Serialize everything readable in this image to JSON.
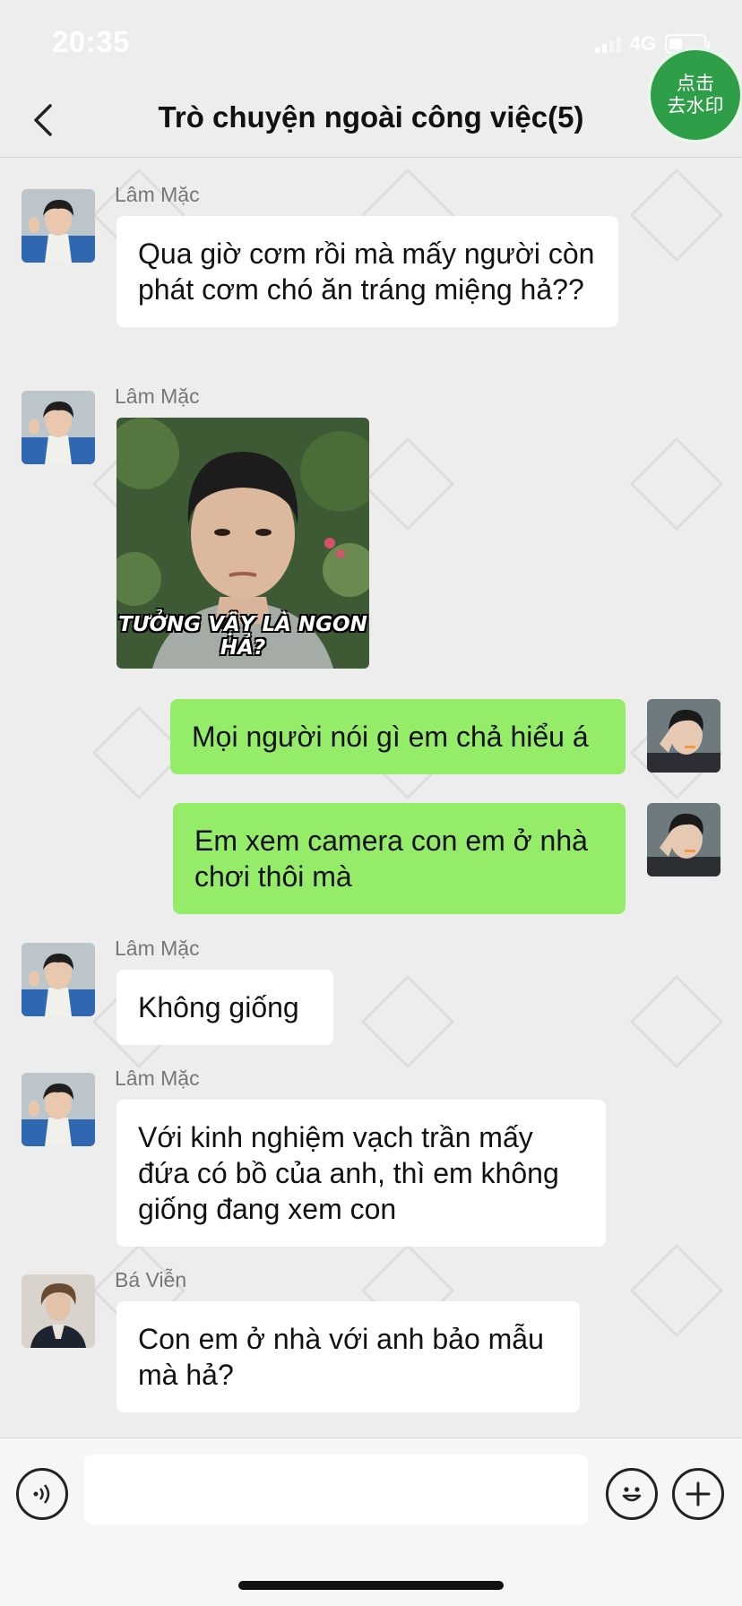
{
  "status_bar": {
    "time": "20:35",
    "network": "4G"
  },
  "header": {
    "title": "Trò chuyện ngoài công việc(5)",
    "back_icon": "chevron-left-icon"
  },
  "watermark_button": {
    "line1": "点击",
    "line2": "去水印"
  },
  "messages": [
    {
      "sender": "Lâm Mặc",
      "text": "Qua giờ cơm rồi mà mấy người còn phát cơm chó ăn tráng miệng hả??",
      "mine": false
    },
    {
      "sender": "Lâm Mặc",
      "type": "sticker",
      "caption": "TƯỞNG VẬY LÀ NGON HẢ?",
      "mine": false
    },
    {
      "text": "Mọi người nói gì em chả hiểu á",
      "mine": true
    },
    {
      "text": "Em xem camera con em ở nhà chơi thôi mà",
      "mine": true
    },
    {
      "sender": "Lâm Mặc",
      "text": "Không giống",
      "mine": false
    },
    {
      "sender": "Lâm Mặc",
      "text": "Với kinh nghiệm vạch trần mấy đứa có bồ của anh, thì em không giống đang xem con",
      "mine": false
    },
    {
      "sender": "Bá Viễn",
      "text": "Con em ở nhà với anh bảo mẫu mà hả?",
      "mine": false
    }
  ],
  "input_bar": {
    "voice_icon": "voice-icon",
    "emoji_icon": "emoji-icon",
    "plus_icon": "plus-icon",
    "input_value": ""
  },
  "colors": {
    "background": "#ededed",
    "my_bubble": "#95ec69",
    "other_bubble": "#ffffff",
    "watermark_button": "#2f9e49"
  }
}
